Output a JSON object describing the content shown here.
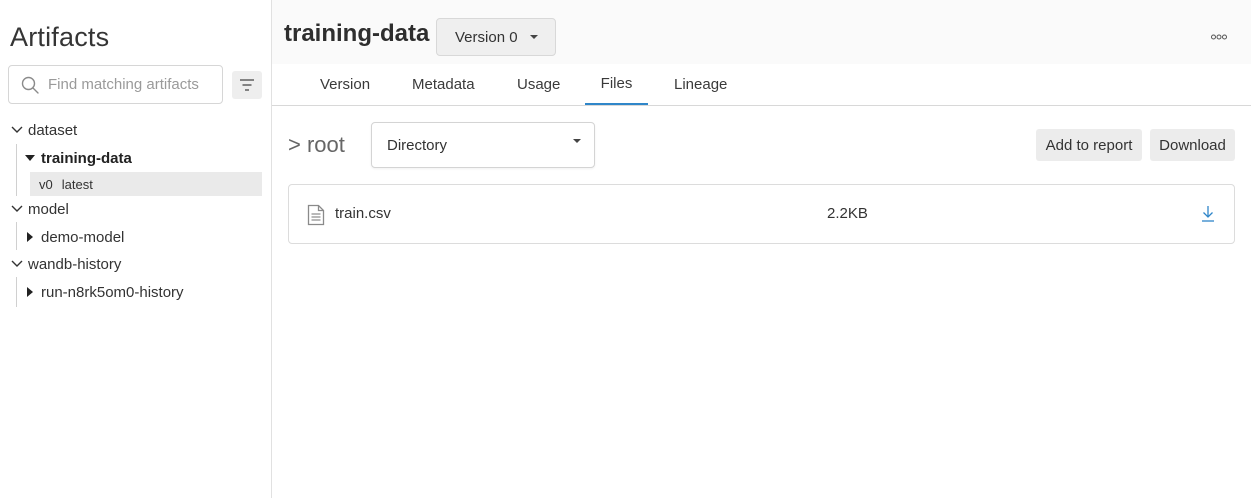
{
  "sidebar": {
    "title": "Artifacts",
    "search": {
      "placeholder": "Find matching artifacts",
      "value": ""
    },
    "tree": {
      "groups": [
        {
          "label": "dataset",
          "expanded": true,
          "children": [
            {
              "label": "training-data",
              "expanded": true,
              "selected": true,
              "versions": [
                {
                  "version": "v0",
                  "alias": "latest"
                }
              ]
            }
          ]
        },
        {
          "label": "model",
          "expanded": true,
          "children": [
            {
              "label": "demo-model",
              "expanded": false
            }
          ]
        },
        {
          "label": "wandb-history",
          "expanded": true,
          "children": [
            {
              "label": "run-n8rk5om0-history",
              "expanded": false
            }
          ]
        }
      ]
    }
  },
  "header": {
    "title": "training-data",
    "version_select": "Version 0"
  },
  "tabs": [
    {
      "label": "Version",
      "active": false
    },
    {
      "label": "Metadata",
      "active": false
    },
    {
      "label": "Usage",
      "active": false
    },
    {
      "label": "Files",
      "active": true
    },
    {
      "label": "Lineage",
      "active": false
    }
  ],
  "files_panel": {
    "path_label": "> root",
    "type_select": "Directory",
    "add_to_report_label": "Add to report",
    "download_label": "Download",
    "files": [
      {
        "name": "train.csv",
        "size": "2.2KB"
      }
    ]
  },
  "colors": {
    "accent": "#2f86c9",
    "selected_row_bg": "#eaeaea",
    "button_bg": "#ececec"
  }
}
